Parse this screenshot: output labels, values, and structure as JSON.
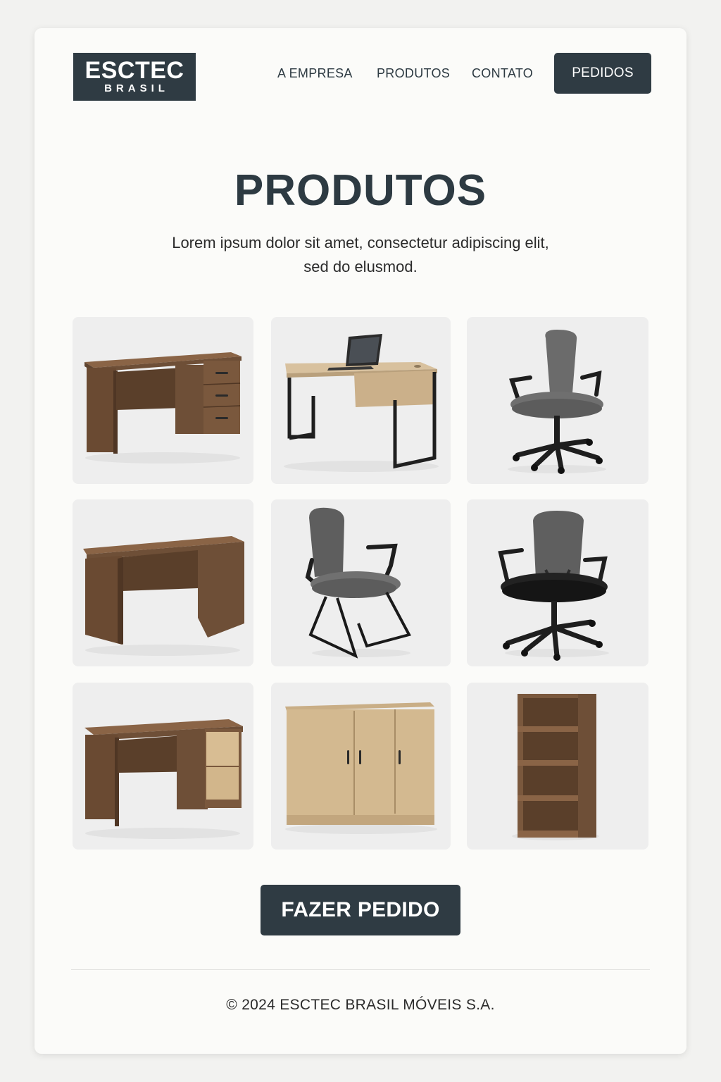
{
  "brand": {
    "name": "ESCTEC",
    "subname": "BRASIL"
  },
  "nav": {
    "items": [
      {
        "label": "A EMPRESA"
      },
      {
        "label": "PRODUTOS"
      },
      {
        "label": "CONTATO"
      }
    ],
    "button_label": "PEDIDOS"
  },
  "hero": {
    "title": "PRODUTOS",
    "subtitle_line1": "Lorem ipsum dolor sit amet, consectetur adipiscing elit,",
    "subtitle_line2": "sed do elusmod."
  },
  "products": [
    {
      "image": "walnut-desk-with-drawers"
    },
    {
      "image": "oak-desk-with-laptop"
    },
    {
      "image": "gray-swivel-office-chair"
    },
    {
      "image": "walnut-desk-simple"
    },
    {
      "image": "gray-cantilever-chair"
    },
    {
      "image": "black-mesh-office-chair"
    },
    {
      "image": "walnut-desk-with-oak-drawers"
    },
    {
      "image": "oak-three-door-cabinet"
    },
    {
      "image": "walnut-bookshelf"
    }
  ],
  "cta": {
    "label": "FAZER PEDIDO"
  },
  "footer": {
    "text": "© 2024 ESCTEC BRASIL MÓVEIS S.A."
  },
  "colors": {
    "primary": "#2f3b43",
    "background": "#fbfbf9",
    "tile": "#eeeeee"
  }
}
